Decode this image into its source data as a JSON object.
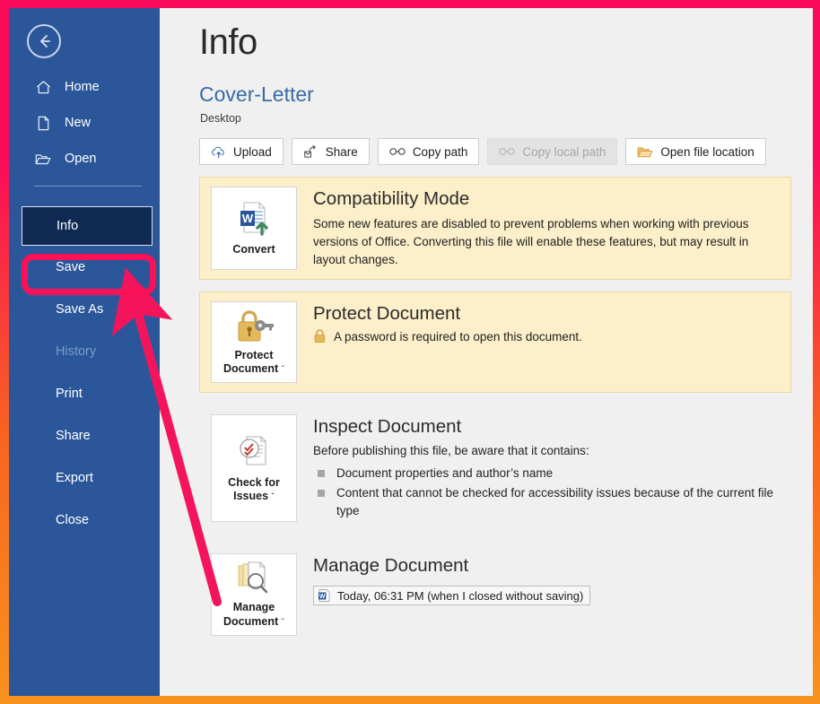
{
  "window": {
    "annotation_border_top_color": "#fa0a5a",
    "annotation_border_bottom_color": "#f7931e",
    "highlight_color": "#fa1157",
    "sidebar_color": "#2b579a",
    "selected_item_color": "#102a54"
  },
  "sidebar": {
    "back_button": "back-arrow",
    "top_items": [
      {
        "icon": "home-icon",
        "label": "Home"
      },
      {
        "icon": "new-document-icon",
        "label": "New"
      },
      {
        "icon": "open-folder-icon",
        "label": "Open"
      }
    ],
    "items": [
      {
        "label": "Info",
        "state": "selected"
      },
      {
        "label": "Save",
        "state": "highlighted"
      },
      {
        "label": "Save As",
        "state": "normal"
      },
      {
        "label": "History",
        "state": "disabled"
      },
      {
        "label": "Print",
        "state": "normal"
      },
      {
        "label": "Share",
        "state": "normal"
      },
      {
        "label": "Export",
        "state": "normal"
      },
      {
        "label": "Close",
        "state": "normal"
      }
    ]
  },
  "header": {
    "title": "Info",
    "document_name": "Cover-Letter",
    "document_path": "Desktop"
  },
  "toolbar": {
    "buttons": [
      {
        "label": "Upload",
        "icon": "cloud-upload-icon",
        "disabled": false
      },
      {
        "label": "Share",
        "icon": "share-icon",
        "disabled": false
      },
      {
        "label": "Copy path",
        "icon": "link-icon",
        "disabled": false
      },
      {
        "label": "Copy local path",
        "icon": "link-icon",
        "disabled": true
      },
      {
        "label": "Open file location",
        "icon": "folder-open-icon",
        "disabled": false
      }
    ]
  },
  "cards": {
    "compatibility": {
      "button_label": "Convert",
      "button_icon": "word-convert-icon",
      "title": "Compatibility Mode",
      "text": "Some new features are disabled to prevent problems when working with previous versions of Office. Converting this file will enable these features, but may result in layout changes."
    },
    "protect": {
      "button_label_line1": "Protect",
      "button_label_line2": "Document",
      "button_caret": "ˇ",
      "button_icon": "lock-key-icon",
      "title": "Protect Document",
      "status_icon": "small-lock-icon",
      "status_text": "A password is required to open this document."
    },
    "inspect": {
      "button_label_line1": "Check for",
      "button_label_line2": "Issues",
      "button_caret": "ˇ",
      "button_icon": "inspect-document-icon",
      "title": "Inspect Document",
      "intro": "Before publishing this file, be aware that it contains:",
      "bullets": [
        "Document properties and author’s name",
        "Content that cannot be checked for accessibility issues because of the current file type"
      ]
    },
    "manage": {
      "button_label_line1": "Manage",
      "button_label_line2": "Document",
      "button_caret": "ˇ",
      "button_icon": "manage-document-icon",
      "title": "Manage Document",
      "version_icon": "word-file-icon",
      "version_text": "Today, 06:31 PM (when I closed without saving)"
    }
  }
}
